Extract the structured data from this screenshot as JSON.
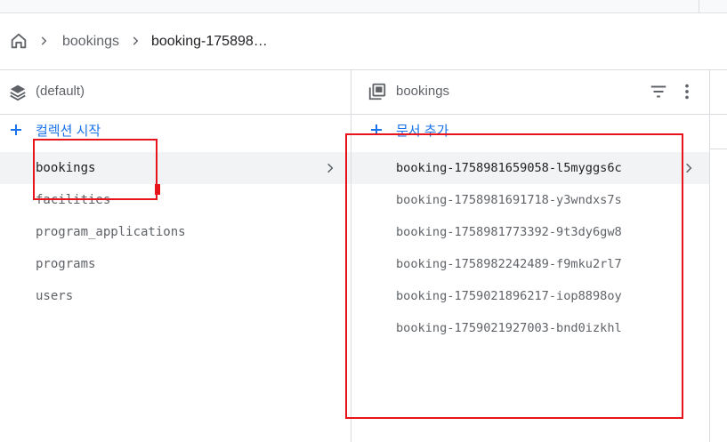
{
  "breadcrumb": {
    "home_icon": "home-icon",
    "items": [
      "bookings",
      "booking-175898…"
    ]
  },
  "collections_panel": {
    "title": "(default)",
    "title_icon": "database-stack-icon",
    "add_label": "컬렉션 시작",
    "items": [
      "bookings",
      "facilities",
      "program_applications",
      "programs",
      "users"
    ],
    "selected": "bookings"
  },
  "documents_panel": {
    "title": "bookings",
    "title_icon": "collection-icon",
    "filter_icon": "filter-icon",
    "menu_icon": "more-vert-icon",
    "add_label": "문서 추가",
    "items": [
      "booking-1758981659058-l5myggs6c",
      "booking-1758981691718-y3wndxs7s",
      "booking-1758981773392-9t3dy6gw8",
      "booking-1758982242489-f9mku2rl7",
      "booking-1759021896217-iop8898oy",
      "booking-1759021927003-bnd0izkhl"
    ],
    "selected": "booking-1758981659058-l5myggs6c"
  },
  "colors": {
    "accent": "#1a73e8",
    "highlight": "#e8141c",
    "selected_bg": "#f1f3f4",
    "border": "#dadce0"
  }
}
